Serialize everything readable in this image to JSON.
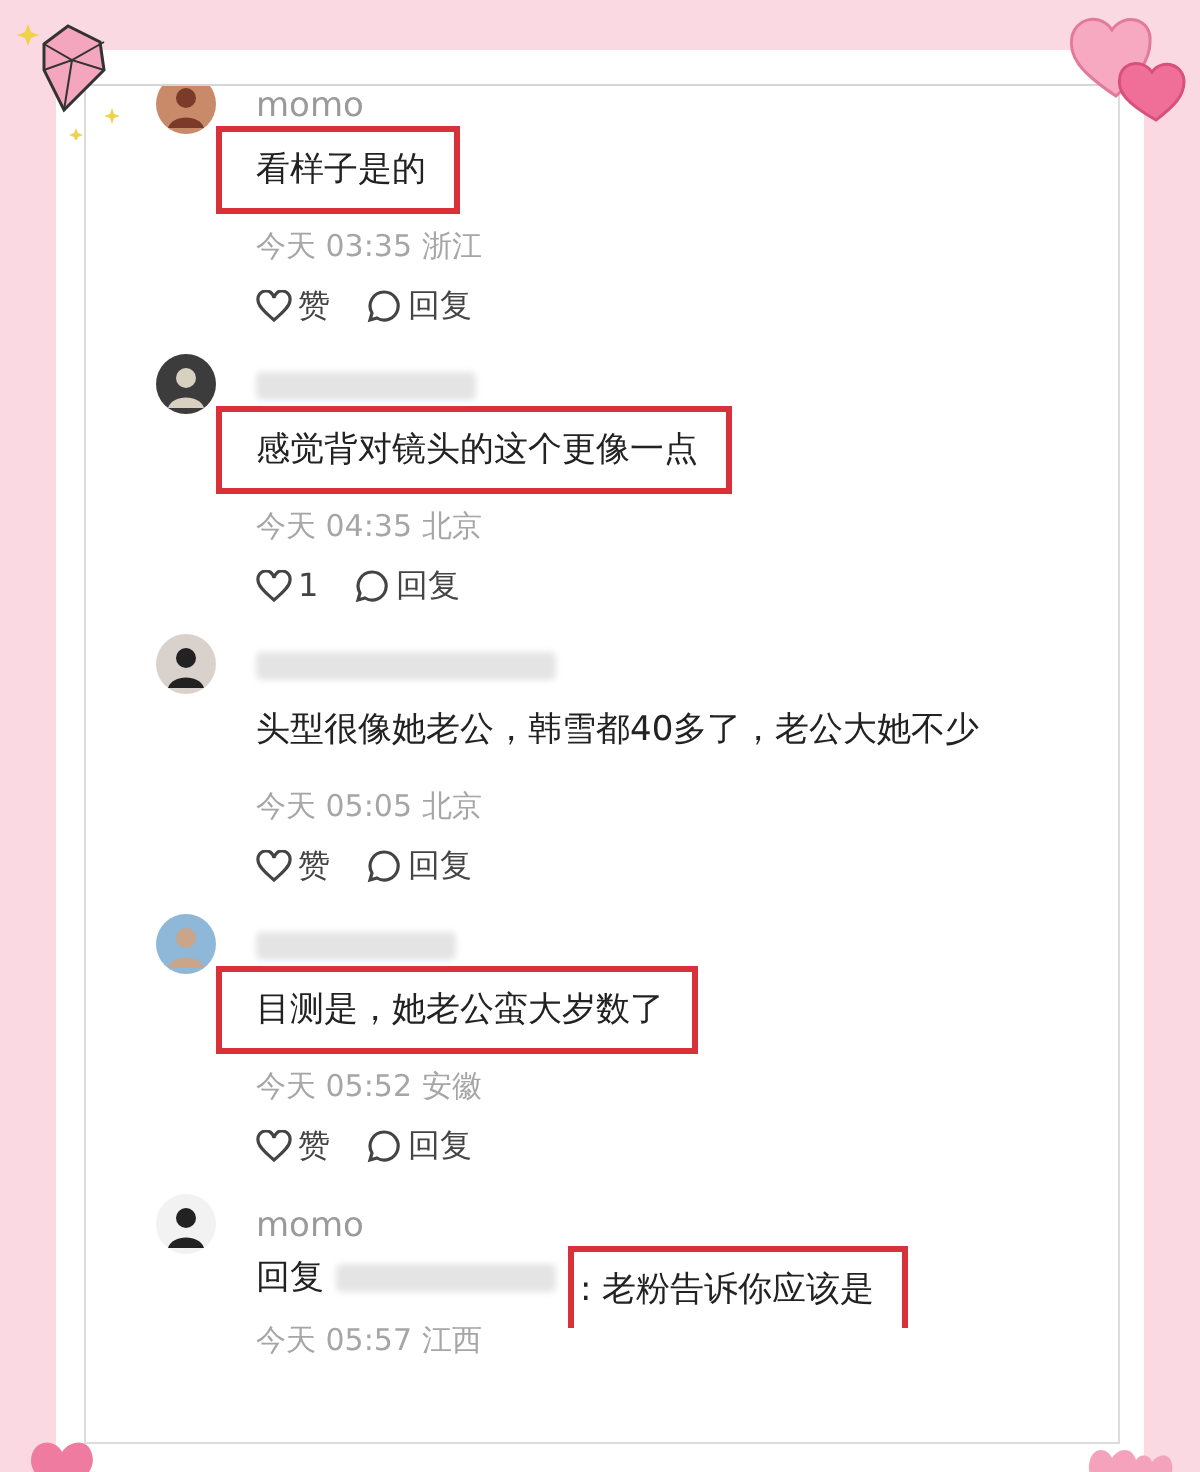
{
  "comments": [
    {
      "user": "momo",
      "text": "看样子是的",
      "highlighted": true,
      "time": "今天 03:35 浙江",
      "like": "赞",
      "reply": "回复"
    },
    {
      "text": "感觉背对镜头的这个更像一点",
      "highlighted": true,
      "time": "今天 04:35 北京",
      "like": "1",
      "reply": "回复"
    },
    {
      "text": "头型很像她老公，韩雪都40多了，老公大她不少",
      "highlighted": false,
      "time": "今天 05:05 北京",
      "like": "赞",
      "reply": "回复"
    },
    {
      "text": "目测是，她老公蛮大岁数了",
      "highlighted": true,
      "time": "今天 05:52 安徽",
      "like": "赞",
      "reply": "回复"
    },
    {
      "user": "momo",
      "reply_prefix": "回复",
      "text": ": 老粉告诉你应该是",
      "highlighted": true,
      "time": "今天 05:57 江西"
    }
  ]
}
